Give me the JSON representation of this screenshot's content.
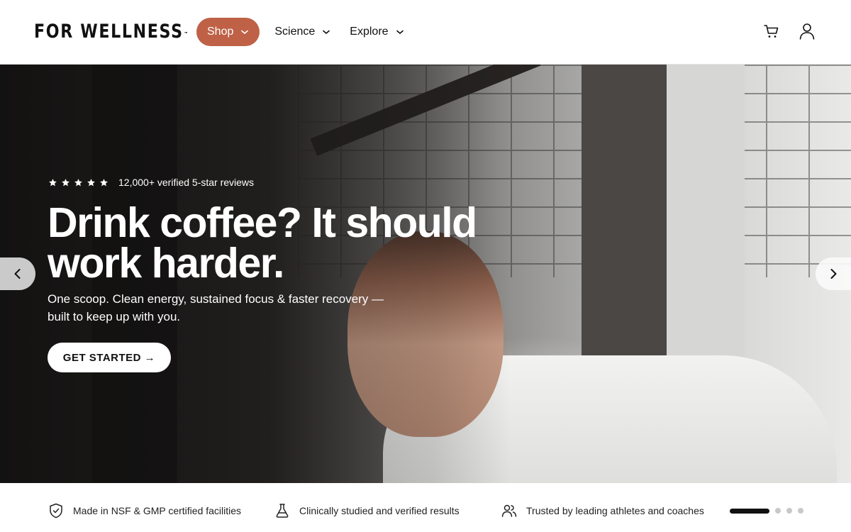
{
  "brand": {
    "logo_text": "FOR WELLNESS",
    "trademark": "™"
  },
  "nav": {
    "items": [
      {
        "label": "Shop",
        "active": true
      },
      {
        "label": "Science",
        "active": false
      },
      {
        "label": "Explore",
        "active": false
      }
    ],
    "accent_color": "#bf6147",
    "cart_icon": "cart-icon",
    "account_icon": "user-icon"
  },
  "hero": {
    "rating_stars": 5,
    "reviews_text": "12,000+ verified 5-star reviews",
    "headline": "Drink coffee? It should work harder.",
    "subline": "One scoop. Clean energy, sustained focus & faster recovery — built to keep up with you.",
    "cta_label": "GET STARTED →",
    "prev_icon": "chevron-left-icon",
    "next_icon": "chevron-right-icon"
  },
  "trust_bar": {
    "items": [
      {
        "icon": "shield-check-icon",
        "text": "Made in NSF & GMP certified facilities"
      },
      {
        "icon": "flask-icon",
        "text": "Clinically studied and verified results"
      },
      {
        "icon": "users-icon",
        "text": "Trusted by leading athletes and coaches"
      }
    ],
    "carousel_total": 4,
    "carousel_active": 1
  }
}
